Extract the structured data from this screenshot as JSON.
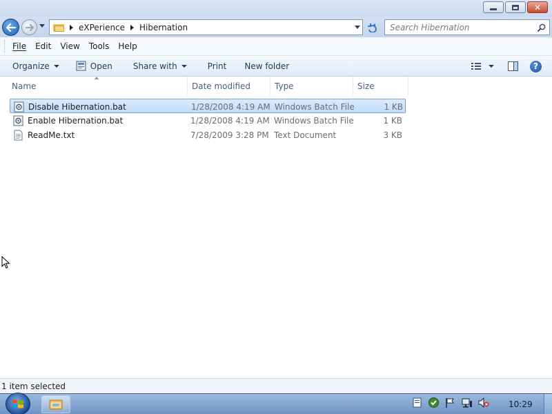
{
  "window": {
    "controls": {
      "minimize": "minimize",
      "maximize": "maximize",
      "close": "close"
    }
  },
  "address": {
    "breadcrumbs": [
      "eXPerience",
      "Hibernation"
    ],
    "search_placeholder": "Search Hibernation"
  },
  "menubar": {
    "items": [
      {
        "label": "File",
        "mnemonic": "F"
      },
      {
        "label": "Edit",
        "mnemonic": "E"
      },
      {
        "label": "View",
        "mnemonic": "V"
      },
      {
        "label": "Tools",
        "mnemonic": "T"
      },
      {
        "label": "Help",
        "mnemonic": "H"
      }
    ]
  },
  "commandbar": {
    "organize": "Organize",
    "open": "Open",
    "share_with": "Share with",
    "print": "Print",
    "new_folder": "New folder"
  },
  "columns": {
    "name": "Name",
    "date_modified": "Date modified",
    "type": "Type",
    "size": "Size"
  },
  "files": [
    {
      "name": "Disable Hibernation.bat",
      "date": "1/28/2008 4:19 AM",
      "type": "Windows Batch File",
      "size": "1 KB",
      "icon": "batch-file-icon",
      "selected": true
    },
    {
      "name": "Enable Hibernation.bat",
      "date": "1/28/2008 4:19 AM",
      "type": "Windows Batch File",
      "size": "1 KB",
      "icon": "batch-file-icon",
      "selected": false
    },
    {
      "name": "ReadMe.txt",
      "date": "7/28/2009 3:28 PM",
      "type": "Text Document",
      "size": "3 KB",
      "icon": "text-file-icon",
      "selected": false
    }
  ],
  "statusbar": {
    "text": "1 item selected"
  },
  "taskbar": {
    "clock": "10:29"
  },
  "colors": {
    "accent": "#1f5fb5",
    "selection": "#c1dcfc",
    "close_button": "#c94a34"
  }
}
